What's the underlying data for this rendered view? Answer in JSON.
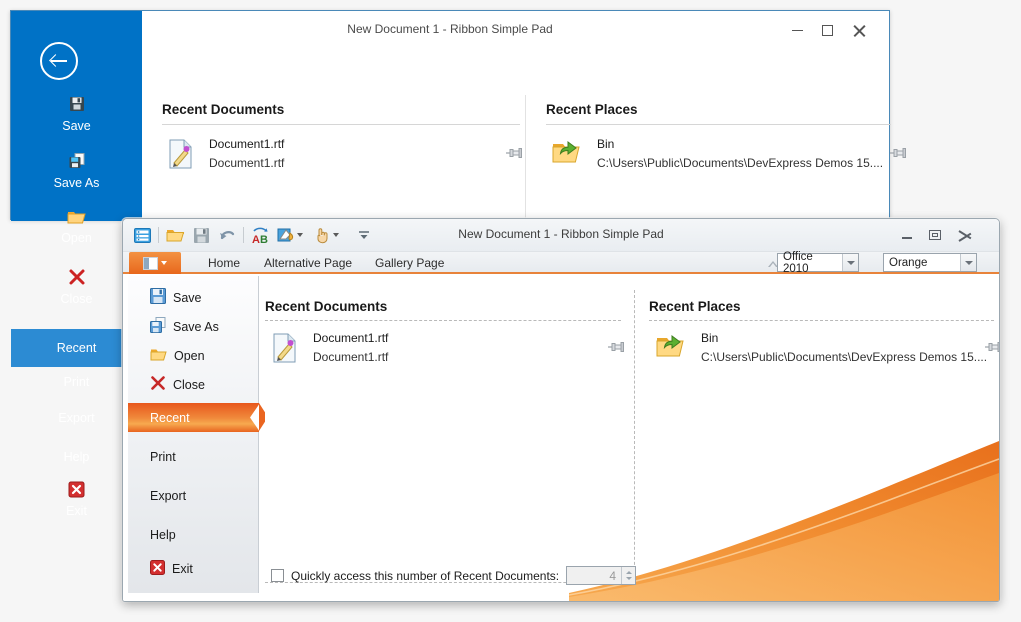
{
  "background_window": {
    "title": "New Document 1 - Ribbon Simple Pad",
    "buttons": {
      "minimize": "minimize-icon",
      "maximize": "maximize-icon",
      "close": "close-icon"
    },
    "backstage": {
      "back_button": "back-arrow-icon",
      "nav_items": [
        {
          "label": "Save",
          "icon": "save-icon"
        },
        {
          "label": "Save As",
          "icon": "save-as-icon"
        },
        {
          "label": "Open",
          "icon": "open-folder-icon"
        },
        {
          "label": "Close",
          "icon": "close-x-icon"
        },
        {
          "label": "Recent",
          "icon": "",
          "selected": true
        },
        {
          "label": "Print",
          "icon": ""
        },
        {
          "label": "Export",
          "icon": ""
        },
        {
          "label": "Help",
          "icon": ""
        },
        {
          "label": "Exit",
          "icon": "exit-icon"
        }
      ],
      "recent_documents": {
        "title": "Recent Documents",
        "items": [
          {
            "name": "Document1.rtf",
            "path": "Document1.rtf",
            "icon": "rtf-document-icon",
            "pin": "pin-icon"
          }
        ]
      },
      "recent_places": {
        "title": "Recent Places",
        "items": [
          {
            "name": "Bin",
            "path": "C:\\Users\\Public\\Documents\\DevExpress Demos 15....",
            "icon": "folder-open-icon",
            "pin": "pin-icon"
          }
        ]
      }
    }
  },
  "foreground_window": {
    "title": "New Document 1 - Ribbon Simple Pad",
    "buttons": {
      "minimize": "minimize-icon",
      "restore": "restore-icon",
      "close": "close-icon"
    },
    "quick_access_toolbar": [
      {
        "name": "ribbon-menu-icon"
      },
      {
        "name": "open-folder-icon"
      },
      {
        "name": "save-icon"
      },
      {
        "name": "undo-icon"
      },
      {
        "name": "spell-check-icon"
      },
      {
        "name": "paint-bucket-icon"
      },
      {
        "name": "touch-mode-icon"
      },
      {
        "name": "customize-qat-icon"
      }
    ],
    "application_button": "application-menu-button",
    "tabs": [
      {
        "label": "Home"
      },
      {
        "label": "Alternative Page"
      },
      {
        "label": "Gallery Page"
      }
    ],
    "collapse_ribbon": "collapse-ribbon-icon",
    "theme_selector": {
      "value": "Office 2010"
    },
    "color_selector": {
      "value": "Orange"
    },
    "backstage_menu": [
      {
        "label": "Save",
        "icon": "save-icon",
        "selected": false
      },
      {
        "label": "Save As",
        "icon": "save-as-icon",
        "selected": false
      },
      {
        "label": "Open",
        "icon": "open-folder-icon",
        "selected": false
      },
      {
        "label": "Close",
        "icon": "close-x-icon",
        "selected": false
      },
      {
        "label": "Recent",
        "icon": "",
        "selected": true
      },
      {
        "label": "Print",
        "icon": "",
        "selected": false
      },
      {
        "label": "Export",
        "icon": "",
        "selected": false
      },
      {
        "label": "Help",
        "icon": "",
        "selected": false
      },
      {
        "label": "Exit",
        "icon": "exit-icon",
        "selected": false
      }
    ],
    "recent_documents": {
      "title": "Recent Documents",
      "items": [
        {
          "name": "Document1.rtf",
          "path": "Document1.rtf",
          "icon": "rtf-document-icon",
          "pin": "pin-icon"
        }
      ]
    },
    "recent_places": {
      "title": "Recent Places",
      "items": [
        {
          "name": "Bin",
          "path": "C:\\Users\\Public\\Documents\\DevExpress Demos 15....",
          "icon": "folder-open-icon",
          "pin": "pin-icon"
        }
      ]
    },
    "quick_access_option": {
      "checkbox_checked": false,
      "label": "Quickly access this number of Recent Documents:",
      "value": "4"
    }
  },
  "colors": {
    "backstage_blue": "#0072c6",
    "backstage_blue_selected": "#2c8bd3",
    "accent_orange": "#e8671c",
    "window_border_blue": "#4a89b8"
  }
}
